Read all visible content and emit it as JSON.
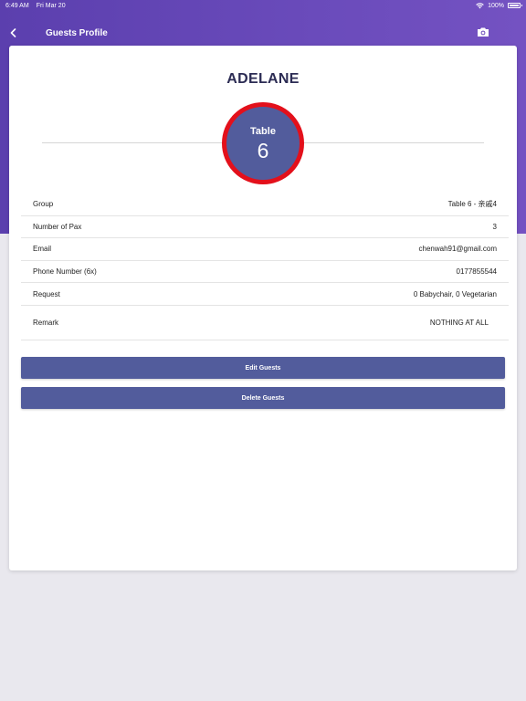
{
  "status_bar": {
    "time": "6:49 AM",
    "date": "Fri Mar 20",
    "battery": "100%"
  },
  "nav": {
    "title": "Guests Profile",
    "back_icon": "chevron-left-icon",
    "camera_icon": "camera-icon"
  },
  "guest": {
    "name": "ADELANE",
    "table_label": "Table",
    "table_number": "6"
  },
  "details": [
    {
      "label": "Group",
      "value": "Table 6 - 亲戚4"
    },
    {
      "label": "Number of Pax",
      "value": "3"
    },
    {
      "label": "Email",
      "value": "chenwah91@gmail.com"
    },
    {
      "label": "Phone Number (6x)",
      "value": "0177855544"
    },
    {
      "label": "Request",
      "value": "0 Babychair, 0 Vegetarian"
    },
    {
      "label": "Remark",
      "value": "NOTHING AT ALL"
    }
  ],
  "actions": {
    "edit_label": "Edit Guests",
    "delete_label": "Delete Guests"
  },
  "colors": {
    "header_purple": "#5b3fae",
    "button_blue": "#525c9c",
    "badge_ring": "#e3101b"
  }
}
